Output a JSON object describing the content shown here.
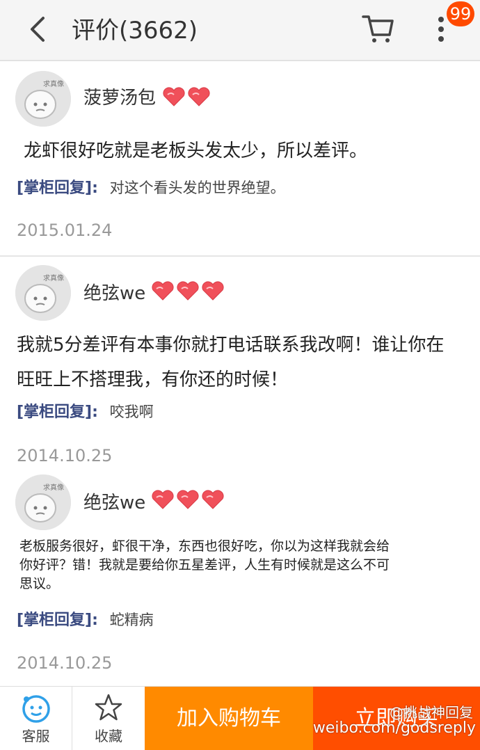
{
  "header": {
    "title": "评价(3662)",
    "badge_count": "99"
  },
  "reviews": [
    {
      "avatar_tag": "求真像",
      "username": "菠萝汤包",
      "hearts": 2,
      "content": "龙虾很好吃就是老板头发太少，所以差评。",
      "reply_label": "[掌柜回复]:",
      "reply": "对这个看头发的世界绝望。",
      "date": "2015.01.24"
    },
    {
      "avatar_tag": "求真像",
      "username": "绝弦we",
      "hearts": 3,
      "content_line1": "我就5分差评有本事你就打电话联系我改啊！谁让你在",
      "content_line2": "旺旺上不搭理我，有你还的时候！",
      "reply_label": "[掌柜回复]:",
      "reply": "咬我啊",
      "date": "2014.10.25"
    },
    {
      "avatar_tag": "求真像",
      "username": "绝弦we",
      "hearts": 3,
      "content_line1": "老板服务很好，虾很干净，东西也很好吃，你以为这样我就会给",
      "content_line2": "你好评？错！我就是要给你五星差评，人生有时候就是这么不可",
      "content_line3": "思议。",
      "reply_label": "[掌柜回复]:",
      "reply": "蛇精病",
      "date": "2014.10.25"
    }
  ],
  "bottom": {
    "service_label": "客服",
    "favorite_label": "收藏",
    "add_cart_label": "加入购物车",
    "buy_label": "立即购买"
  },
  "watermark": {
    "line1": "@挑战神回复",
    "line2": "weibo.com/godsreply"
  },
  "colors": {
    "accent_orange": "#ff8a00",
    "accent_red": "#ff4e00",
    "badge": "#ff4a00",
    "heart": "#f0505a",
    "reply_label": "#3a4a80"
  }
}
